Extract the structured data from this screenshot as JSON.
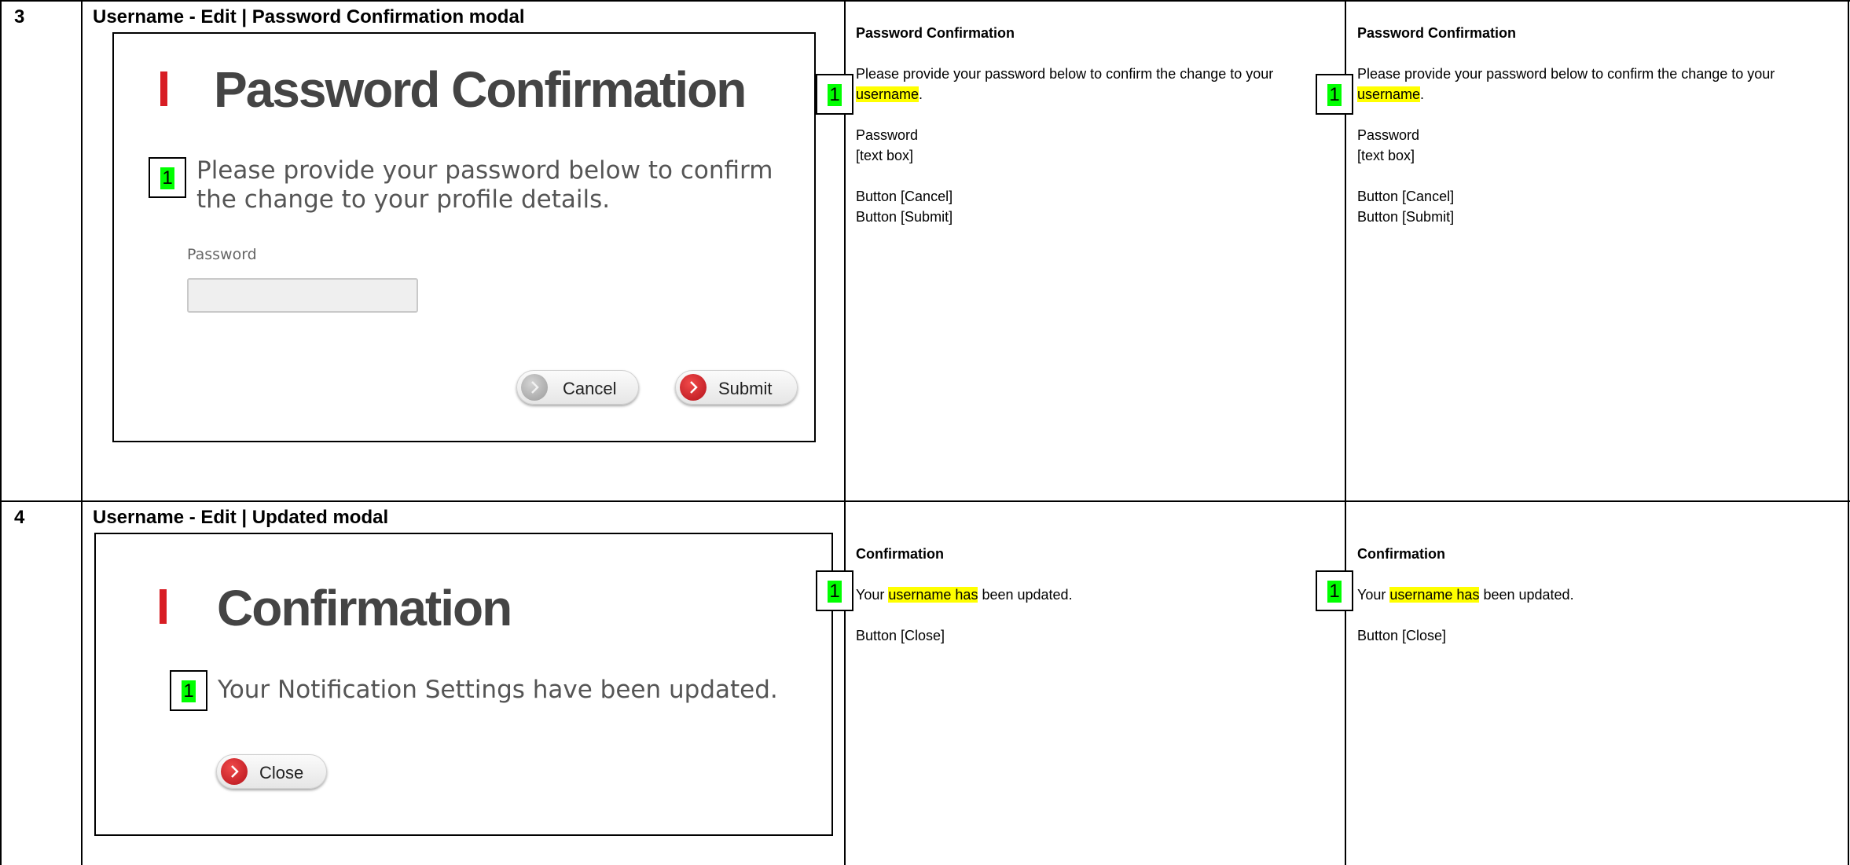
{
  "rows": [
    {
      "number": "3",
      "title": "Username - Edit | Password Confirmation  modal",
      "modal": {
        "heading": "Password Confirmation",
        "marker": "1",
        "body_line1": "Please provide your password below to confirm",
        "body_line2": "the change to your profile details.",
        "password_label": "Password",
        "cancel_label": "Cancel",
        "submit_label": "Submit"
      },
      "spec_columns": [
        {
          "heading": "Password Confirmation",
          "marker": "1",
          "body_pre": "Please provide your password below to confirm the change to your ",
          "body_highlight": "username",
          "body_post": ".",
          "field_label": "Password",
          "field_control": "[text box]",
          "button_1": "Button [Cancel]",
          "button_2": "Button [Submit]"
        },
        {
          "heading": "Password Confirmation",
          "marker": "1",
          "body_pre": "Please provide your password below to confirm the change to your ",
          "body_highlight": "username",
          "body_post": ".",
          "field_label": "Password",
          "field_control": "[text box]",
          "button_1": "Button [Cancel]",
          "button_2": "Button [Submit]"
        }
      ]
    },
    {
      "number": "4",
      "title": "Username - Edit | Updated  modal",
      "modal": {
        "heading": "Confirmation",
        "marker": "1",
        "body": "Your Notification Settings have been updated.",
        "close_label": "Close"
      },
      "spec_columns": [
        {
          "heading": "Confirmation",
          "marker": "1",
          "body_pre": "Your ",
          "body_highlight": "username has",
          "body_post": " been updated.",
          "button_1": "Button [Close]"
        },
        {
          "heading": "Confirmation",
          "marker": "1",
          "body_pre": "Your ",
          "body_highlight": "username has",
          "body_post": " been updated.",
          "button_1": "Button [Close]"
        }
      ]
    }
  ],
  "colors": {
    "accent_red": "#d81d24",
    "marker_green": "#00ff00",
    "highlight_yellow": "#ffff00",
    "heading_gray": "#444444"
  }
}
